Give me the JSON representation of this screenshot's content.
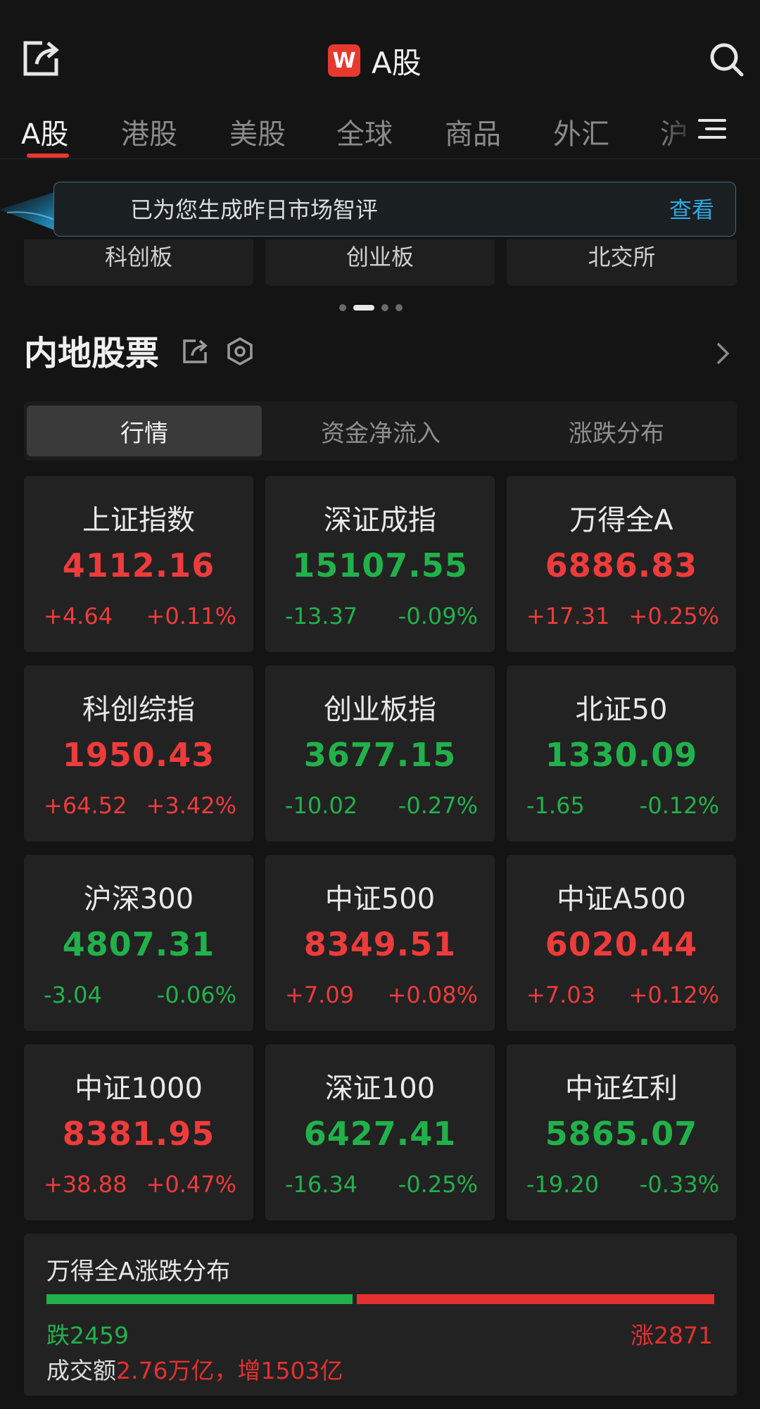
{
  "header": {
    "title": "A股",
    "logo_letter": "W"
  },
  "tabs": [
    "A股",
    "港股",
    "美股",
    "全球",
    "商品",
    "外汇",
    "沪"
  ],
  "banner": {
    "text": "已为您生成昨日市场智评",
    "link": "查看"
  },
  "boards": [
    "科创板",
    "创业板",
    "北交所"
  ],
  "section": {
    "title": "内地股票"
  },
  "segments": [
    "行情",
    "资金净流入",
    "涨跌分布"
  ],
  "indices": [
    {
      "name": "上证指数",
      "price": "4112.16",
      "change": "+4.64",
      "pct": "+0.11%",
      "dir": "up"
    },
    {
      "name": "深证成指",
      "price": "15107.55",
      "change": "-13.37",
      "pct": "-0.09%",
      "dir": "down"
    },
    {
      "name": "万得全A",
      "price": "6886.83",
      "change": "+17.31",
      "pct": "+0.25%",
      "dir": "up"
    },
    {
      "name": "科创综指",
      "price": "1950.43",
      "change": "+64.52",
      "pct": "+3.42%",
      "dir": "up"
    },
    {
      "name": "创业板指",
      "price": "3677.15",
      "change": "-10.02",
      "pct": "-0.27%",
      "dir": "down"
    },
    {
      "name": "北证50",
      "price": "1330.09",
      "change": "-1.65",
      "pct": "-0.12%",
      "dir": "down"
    },
    {
      "name": "沪深300",
      "price": "4807.31",
      "change": "-3.04",
      "pct": "-0.06%",
      "dir": "down"
    },
    {
      "name": "中证500",
      "price": "8349.51",
      "change": "+7.09",
      "pct": "+0.08%",
      "dir": "up"
    },
    {
      "name": "中证A500",
      "price": "6020.44",
      "change": "+7.03",
      "pct": "+0.12%",
      "dir": "up"
    },
    {
      "name": "中证1000",
      "price": "8381.95",
      "change": "+38.88",
      "pct": "+0.47%",
      "dir": "up"
    },
    {
      "name": "深证100",
      "price": "6427.41",
      "change": "-16.34",
      "pct": "-0.25%",
      "dir": "down"
    },
    {
      "name": "中证红利",
      "price": "5865.07",
      "change": "-19.20",
      "pct": "-0.33%",
      "dir": "down"
    }
  ],
  "distribution": {
    "title": "万得全A涨跌分布",
    "down_label": "跌2459",
    "up_label": "涨2871",
    "down_count": 2459,
    "up_count": 2871,
    "turnover_prefix": "成交额",
    "turnover_value": "2.76万亿，增1503亿"
  },
  "colors": {
    "up": "#ee3b3b",
    "down": "#21b14b",
    "accent": "#e8392f",
    "link": "#2fa7e0"
  }
}
